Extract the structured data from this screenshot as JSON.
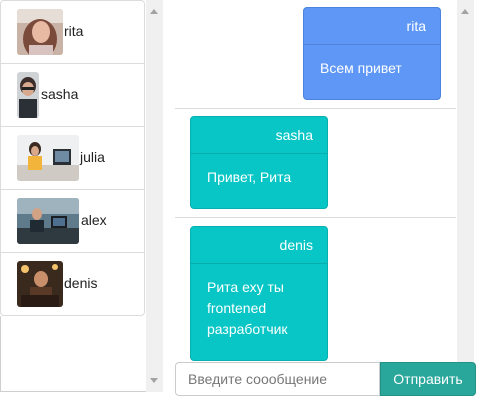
{
  "contacts": [
    {
      "name": "rita"
    },
    {
      "name": "sasha"
    },
    {
      "name": "julia"
    },
    {
      "name": "alex"
    },
    {
      "name": "denis"
    }
  ],
  "messages": [
    {
      "author": "rita",
      "text": "Всем привет",
      "color": "#5e97f6"
    },
    {
      "author": "sasha",
      "text": "Привет, Рита",
      "color": "#08c6c6"
    },
    {
      "author": "denis",
      "text": "Рита еху ты frontened разработчик",
      "color": "#08c6c6"
    }
  ],
  "composer": {
    "placeholder": "Введите соообщение",
    "send_label": "Отправить",
    "send_color": "#2aa79b"
  }
}
